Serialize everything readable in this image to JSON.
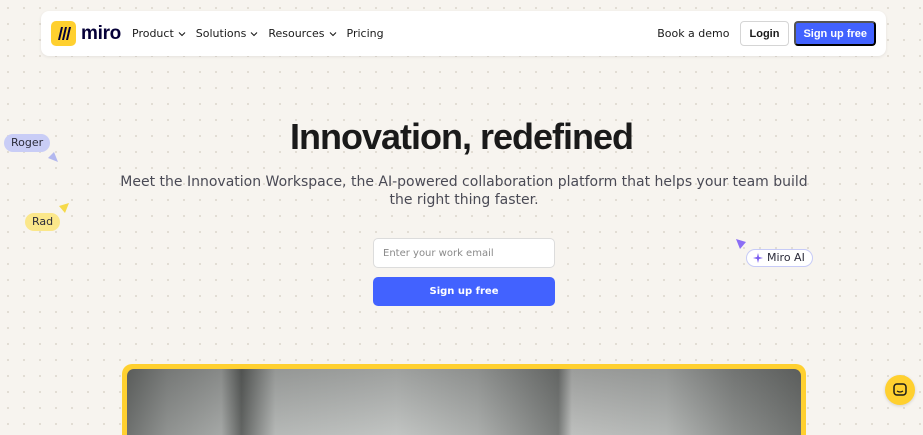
{
  "brand": {
    "name": "miro"
  },
  "nav": {
    "items": [
      {
        "label": "Product",
        "has_dropdown": true
      },
      {
        "label": "Solutions",
        "has_dropdown": true
      },
      {
        "label": "Resources",
        "has_dropdown": true
      },
      {
        "label": "Pricing",
        "has_dropdown": false
      }
    ],
    "book_demo": "Book a demo",
    "login": "Login",
    "signup": "Sign up free"
  },
  "hero": {
    "title": "Innovation, redefined",
    "subtitle": "Meet the Innovation Workspace, the AI-powered collaboration platform that helps your team build the right thing faster.",
    "email_placeholder": "Enter your work email",
    "signup_button": "Sign up free"
  },
  "cursors": {
    "roger": "Roger",
    "rad": "Rad",
    "ai": "Miro AI"
  },
  "colors": {
    "accent": "#4262ff",
    "brand_yellow": "#ffd02f",
    "background": "#f7f4ef"
  },
  "icons": [
    "miro-logo-icon",
    "chevron-down-icon",
    "sparkle-icon",
    "cursor-arrow-icon",
    "chat-icon"
  ]
}
